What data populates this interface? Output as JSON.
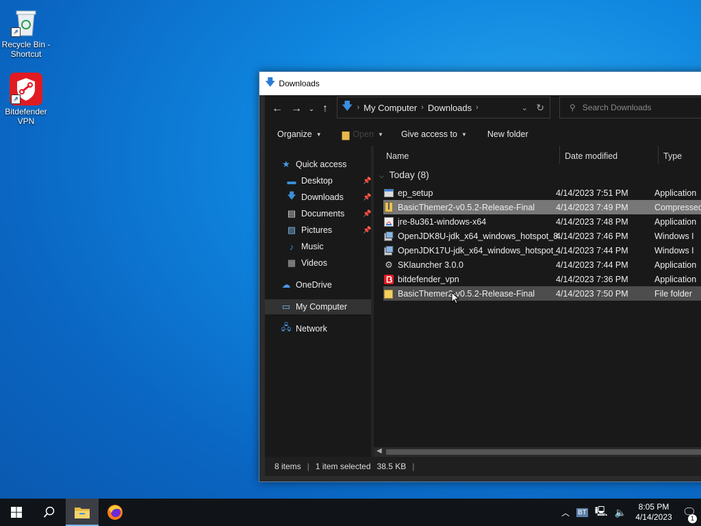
{
  "desktop": {
    "icons": [
      {
        "label": "Recycle Bin - Shortcut"
      },
      {
        "label": "Bitdefender VPN"
      }
    ]
  },
  "window": {
    "title": "Downloads",
    "address": {
      "crumbs": [
        "My Computer",
        "Downloads"
      ]
    },
    "search": {
      "placeholder": "Search Downloads"
    },
    "toolbar": {
      "organize": "Organize",
      "open": "Open",
      "give_access": "Give access to",
      "new_folder": "New folder"
    },
    "nav": {
      "quick_access": "Quick access",
      "items": [
        "Desktop",
        "Downloads",
        "Documents",
        "Pictures",
        "Music",
        "Videos"
      ],
      "onedrive": "OneDrive",
      "my_computer": "My Computer",
      "network": "Network"
    },
    "columns": {
      "name": "Name",
      "date": "Date modified",
      "type": "Type"
    },
    "group": "Today (8)",
    "files": [
      {
        "name": "ep_setup",
        "date": "4/14/2023 7:51 PM",
        "type": "Application",
        "icon": "app-icon"
      },
      {
        "name": "BasicThemer2-v0.5.2-Release-Final",
        "date": "4/14/2023 7:49 PM",
        "type": "Compressed",
        "icon": "zip-icon"
      },
      {
        "name": "jre-8u361-windows-x64",
        "date": "4/14/2023 7:48 PM",
        "type": "Application",
        "icon": "java-icon"
      },
      {
        "name": "OpenJDK8U-jdk_x64_windows_hotspot_8...",
        "date": "4/14/2023 7:46 PM",
        "type": "Windows I",
        "icon": "installer-icon"
      },
      {
        "name": "OpenJDK17U-jdk_x64_windows_hotspot_...",
        "date": "4/14/2023 7:44 PM",
        "type": "Windows I",
        "icon": "installer-icon"
      },
      {
        "name": "SKlauncher 3.0.0",
        "date": "4/14/2023 7:44 PM",
        "type": "Application",
        "icon": "gear-icon"
      },
      {
        "name": "bitdefender_vpn",
        "date": "4/14/2023 7:36 PM",
        "type": "Application",
        "icon": "bitdefender-icon"
      },
      {
        "name": "BasicThemer2-v0.5.2-Release-Final",
        "date": "4/14/2023 7:50 PM",
        "type": "File folder",
        "icon": "folder-icon"
      }
    ],
    "status": {
      "count": "8 items",
      "selected": "1 item selected",
      "size": "38.5 KB"
    }
  },
  "taskbar": {
    "clock_time": "8:05 PM",
    "clock_date": "4/14/2023",
    "notification_count": "1",
    "tray_badge": "BT"
  }
}
